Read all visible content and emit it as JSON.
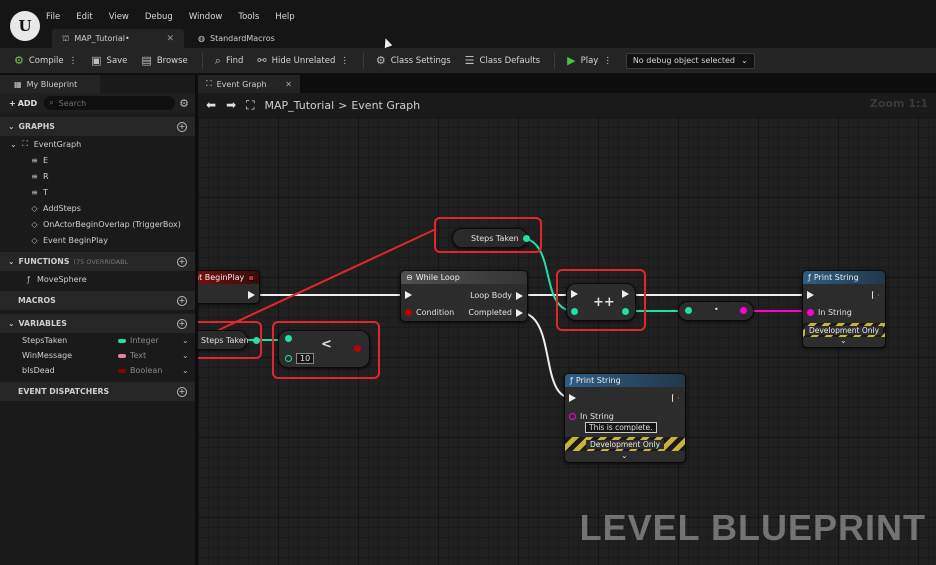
{
  "menu": [
    "File",
    "Edit",
    "View",
    "Debug",
    "Window",
    "Tools",
    "Help"
  ],
  "doc_tabs": [
    {
      "label": "MAP_Tutorial•",
      "close": "✕"
    },
    {
      "label": "StandardMacros"
    }
  ],
  "toolbar": {
    "compile": "Compile",
    "save": "Save",
    "browse": "Browse",
    "find": "Find",
    "hide_unrelated": "Hide Unrelated",
    "class_settings": "Class Settings",
    "class_defaults": "Class Defaults",
    "play": "Play",
    "debug_object": "No debug object selected"
  },
  "left_panel": {
    "tab": "My Blueprint",
    "add": "ADD",
    "search_placeholder": "Search",
    "graphs_header": "GRAPHS",
    "event_graph": "EventGraph",
    "graph_items": [
      "E",
      "R",
      "T",
      "AddSteps",
      "OnActorBeginOverlap (TriggerBox)",
      "Event BeginPlay"
    ],
    "functions_header": "FUNCTIONS",
    "functions_sub": "(75 OVERRIDABL",
    "functions": [
      "MoveSphere"
    ],
    "macros_header": "MACROS",
    "variables_header": "VARIABLES",
    "variables": [
      {
        "name": "StepsTaken",
        "type": "Integer",
        "color": "#1fe0a8"
      },
      {
        "name": "WinMessage",
        "type": "Text",
        "color": "#e87fa8"
      },
      {
        "name": "bIsDead",
        "type": "Boolean",
        "color": "#8c0000"
      }
    ],
    "dispatchers_header": "EVENT DISPATCHERS"
  },
  "graph_tab": "Event Graph",
  "breadcrumb": {
    "root": "MAP_Tutorial",
    "separator": ">",
    "current": "Event Graph"
  },
  "zoom": "Zoom 1:1",
  "nodes": {
    "begin_play": "nt BeginPlay",
    "steps_taken_top": "Steps Taken",
    "steps_taken_left": "Steps Taken",
    "while_loop": "While Loop",
    "loop_body": "Loop Body",
    "condition": "Condition",
    "completed": "Completed",
    "less_op": "<",
    "less_value": "10",
    "increment": "++",
    "mul_op": "•",
    "print_a": "Print String",
    "print_a_in": "In String",
    "print_a_dev": "Development Only",
    "print_b": "Print String",
    "print_b_in": "In String",
    "print_b_value": "This is complete.",
    "print_b_dev": "Development Only"
  },
  "colors": {
    "highlight": "#e2262d",
    "integer": "#1fe0a8",
    "string": "#ff00d4",
    "bool": "#8c0000",
    "exec": "#eeeeee"
  },
  "watermark": "LEVEL BLUEPRINT"
}
